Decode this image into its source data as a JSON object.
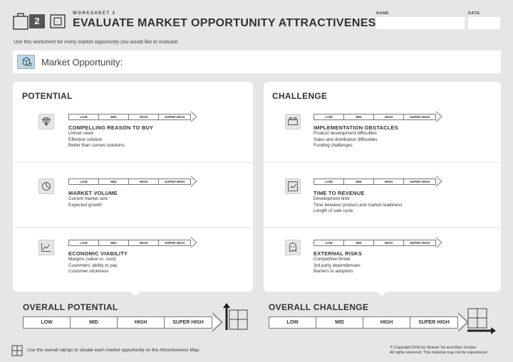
{
  "header": {
    "worksheet_label": "WORKSHEET 2",
    "number": "2",
    "title": "EVALUATE MARKET OPPORTUNITY ATTRACTIVENESS",
    "name_label": "NAME",
    "date_label": "DATE",
    "name_value": "",
    "date_value": ""
  },
  "subtitle": "Use this worksheet for every market opportunity you would like to evaluate.",
  "market_opportunity": {
    "label": "Market Opportunity:",
    "value": ""
  },
  "scale_labels": [
    "LOW",
    "MID",
    "HIGH",
    "SUPER HIGH"
  ],
  "potential": {
    "title": "POTENTIAL",
    "criteria": [
      {
        "title": "COMPELLING REASON TO BUY",
        "icon": "diamond-icon",
        "items": [
          "Unmet need",
          "Effective solution",
          "Better than current solutions"
        ]
      },
      {
        "title": "MARKET VOLUME",
        "icon": "pie-chart-icon",
        "items": [
          "Current market size",
          "Expected growth"
        ]
      },
      {
        "title": "ECONOMIC VIABILITY",
        "icon": "line-chart-icon",
        "items": [
          "Margins (value vs. cost)",
          "Customers' ability to pay",
          "Customer stickiness"
        ]
      }
    ],
    "overall_title": "OVERALL POTENTIAL"
  },
  "challenge": {
    "title": "CHALLENGE",
    "criteria": [
      {
        "title": "IMPLEMENTATION OBSTACLES",
        "icon": "bricks-icon",
        "items": [
          "Product development difficulties",
          "Sales and distribution difficulties",
          "Funding challenges"
        ]
      },
      {
        "title": "TIME TO REVENUE",
        "icon": "clock-chart-icon",
        "items": [
          "Development time",
          "Time between product and market readiness",
          "Length of sale cycle"
        ]
      },
      {
        "title": "EXTERNAL RISKS",
        "icon": "ghost-icon",
        "items": [
          "Competitive threat",
          "3rd party dependencies",
          "Barriers to adoption"
        ]
      }
    ],
    "overall_title": "OVERALL CHALLENGE"
  },
  "footer": {
    "instruction": "Use the overall ratings to situate each market opportunity on the Attractiveness Map.",
    "copyright_line1": "© Copyright 2016 by Sharon Tal and Marc Gruber.",
    "copyright_line2": "All rights reserved. This material may not be reproduced"
  },
  "colors": {
    "background": "#e6e6e6",
    "panel": "#ffffff",
    "accent_box": "#555555",
    "icon_highlight": "#bcd8e6"
  }
}
